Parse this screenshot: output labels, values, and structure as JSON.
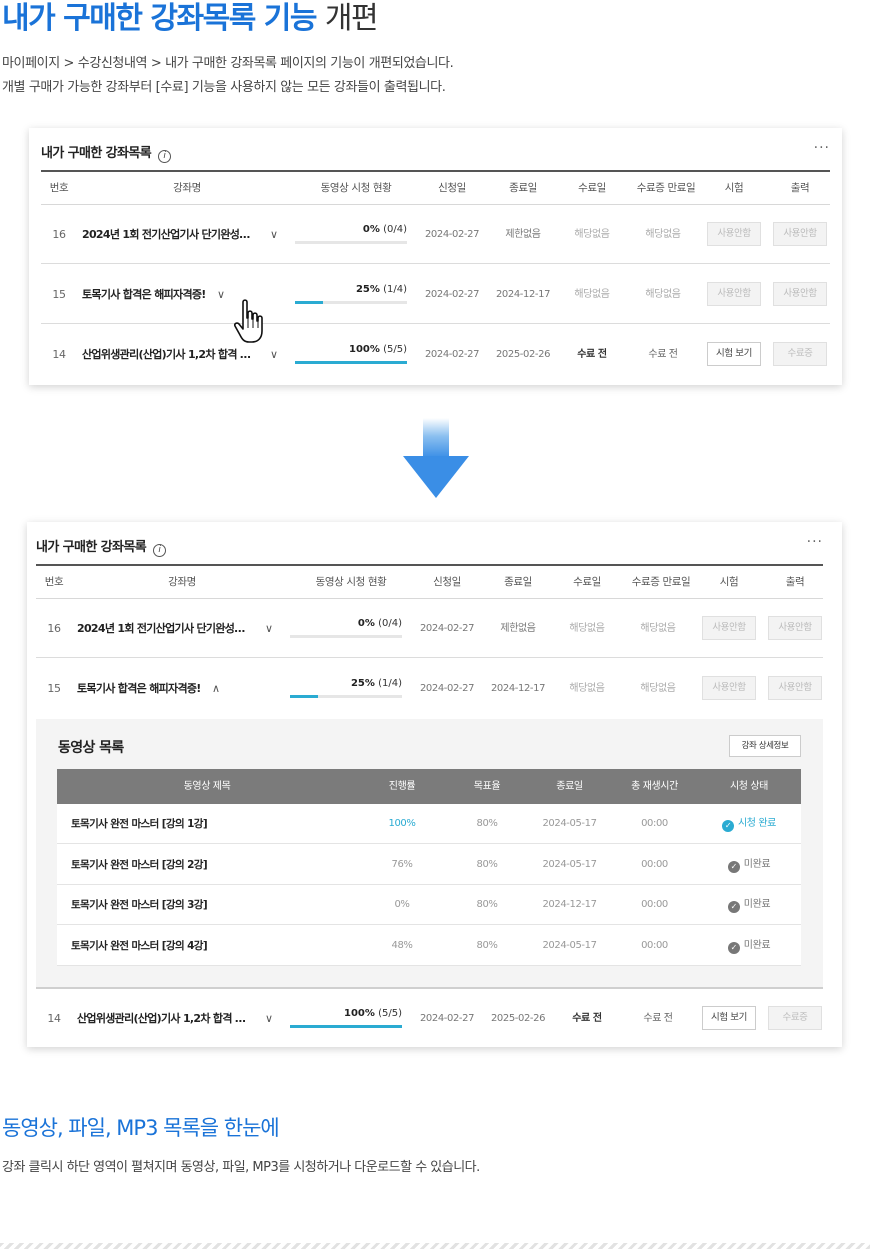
{
  "hero": {
    "title_accent": "내가 구매한 강좌목록 기능",
    "title_normal": "개편",
    "desc_line1": "마이페이지 > 수강신청내역 > 내가 구매한 강좌목록 페이지의 기능이 개편되었습니다.",
    "desc_line2": "개별 구매가 가능한 강좌부터 [수료] 기능을 사용하지 않는 모든 강좌들이 출력됩니다."
  },
  "panel": {
    "title": "내가 구매한 강좌목록",
    "info_glyph": "i",
    "more_glyph": "···",
    "headers": [
      "번호",
      "강좌명",
      "동영상 시청 현황",
      "신청일",
      "종료일",
      "수료일",
      "수료증 만료일",
      "시험",
      "출력"
    ],
    "rows": [
      {
        "num": "16",
        "name": "2024년 1회 전기산업기사 단기완성…",
        "chevron": "∨",
        "chevron_open": "∨",
        "progress_pct": "0%",
        "progress_count": "(0/4)",
        "progress": 0,
        "apply": "2024-02-27",
        "end": "제한없음",
        "complete": "해당없음",
        "cert_expire": "해당없음",
        "exam": "사용안함",
        "print": "사용안함",
        "exam_active": false,
        "print_active": false,
        "complete_strong": false
      },
      {
        "num": "15",
        "name": "토목기사 합격은 해피자격증!",
        "chevron": "∨",
        "chevron_open": "∧",
        "progress_pct": "25%",
        "progress_count": "(1/4)",
        "progress": 0.25,
        "apply": "2024-02-27",
        "end": "2024-12-17",
        "complete": "해당없음",
        "cert_expire": "해당없음",
        "exam": "사용안함",
        "print": "사용안함",
        "exam_active": false,
        "print_active": false,
        "complete_strong": false
      },
      {
        "num": "14",
        "name": "산업위생관리(산업)기사 1,2차 합격 …",
        "chevron": "∨",
        "chevron_open": "∨",
        "progress_pct": "100%",
        "progress_count": "(5/5)",
        "progress": 1.0,
        "apply": "2024-02-27",
        "end": "2025-02-26",
        "complete": "수료 전",
        "cert_expire": "수료 전",
        "exam": "시험 보기",
        "print": "수료증",
        "exam_active": true,
        "print_active": false,
        "complete_strong": true
      }
    ]
  },
  "video_list": {
    "title": "동영상 목록",
    "detail_button": "강좌 상세정보",
    "headers": [
      "동영상 제목",
      "진행률",
      "목표율",
      "종료일",
      "총 재생시간",
      "시청 상태"
    ],
    "rows": [
      {
        "title": "토목기사 완전 마스터 [강의 1강]",
        "progress": "100%",
        "target": "80%",
        "end": "2024-05-17",
        "duration": "00:00",
        "status": "시청 완료",
        "done": true
      },
      {
        "title": "토목기사 완전 마스터 [강의 2강]",
        "progress": "76%",
        "target": "80%",
        "end": "2024-05-17",
        "duration": "00:00",
        "status": "미완료",
        "done": false
      },
      {
        "title": "토목기사 완전 마스터 [강의 3강]",
        "progress": "0%",
        "target": "80%",
        "end": "2024-12-17",
        "duration": "00:00",
        "status": "미완료",
        "done": false
      },
      {
        "title": "토목기사 완전 마스터 [강의 4강]",
        "progress": "48%",
        "target": "80%",
        "end": "2024-05-17",
        "duration": "00:00",
        "status": "미완료",
        "done": false
      }
    ]
  },
  "section": {
    "title": "동영상, 파일, MP3 목록을 한눈에",
    "desc": "강좌 클릭시 하단 영역이 펼쳐지며 동영상, 파일, MP3를 시청하거나 다운로드할 수 있습니다."
  },
  "colors": {
    "accent": "#1a73d8",
    "progress": "#2aabd2",
    "header_dark": "#7b7b7b"
  },
  "icons": {
    "cursor": "hand-pointer-icon",
    "arrow": "down-arrow-icon",
    "check": "check-circle-icon"
  }
}
